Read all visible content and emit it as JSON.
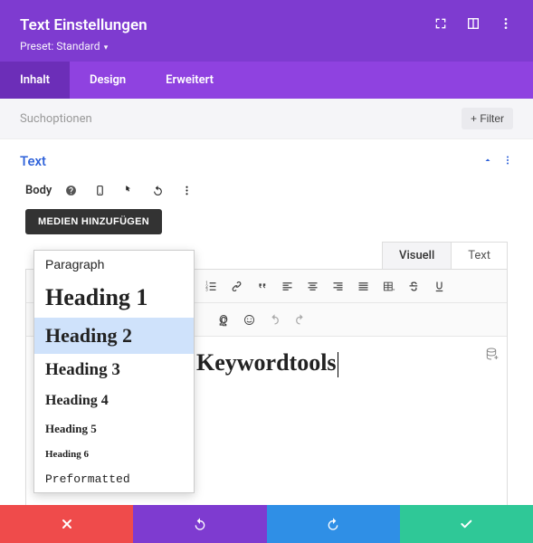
{
  "header": {
    "title": "Text Einstellungen",
    "preset_label": "Preset: Standard"
  },
  "tabs": {
    "content": "Inhalt",
    "design": "Design",
    "advanced": "Erweitert"
  },
  "search": {
    "placeholder": "Suchoptionen",
    "filter": "Filter"
  },
  "section": {
    "label": "Text"
  },
  "body_row": {
    "label": "Body"
  },
  "media_button": "MEDIEN HINZUFÜGEN",
  "mode_tabs": {
    "visual": "Visuell",
    "text": "Text"
  },
  "format_select": {
    "current": "Heading 2",
    "options": {
      "paragraph": "Paragraph",
      "h1": "Heading 1",
      "h2": "Heading 2",
      "h3": "Heading 3",
      "h4": "Heading 4",
      "h5": "Heading 5",
      "h6": "Heading 6",
      "pre": "Preformatted"
    }
  },
  "content": {
    "text": "Keywordtools"
  }
}
